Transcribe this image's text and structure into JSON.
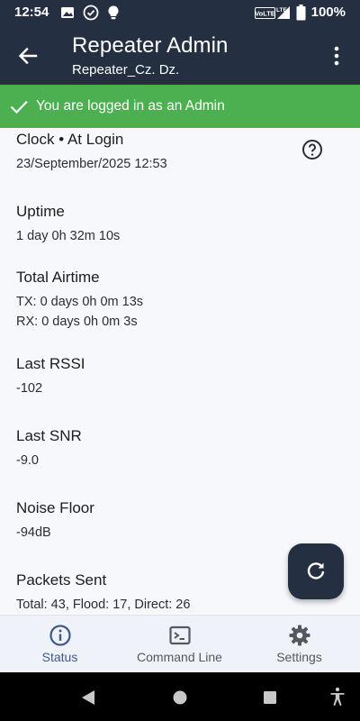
{
  "status_bar": {
    "time": "12:54",
    "left_icons": [
      "image-icon",
      "check-circle-icon",
      "lightbulb-icon"
    ],
    "right_icons": [
      "volte-icon",
      "lte-signal-icon",
      "battery-icon"
    ],
    "volte_label": "VoLTE",
    "lte_label": "LTE",
    "battery": "100%"
  },
  "app_bar": {
    "title": "Repeater Admin",
    "subtitle": "Repeater_Cz. Dz."
  },
  "banner": {
    "text": "You are logged in as an Admin",
    "color": "#4caf50"
  },
  "stats": [
    {
      "title": "Clock • At Login",
      "lines": [
        "23/September/2025 12:53"
      ]
    },
    {
      "title": "Uptime",
      "lines": [
        "1 day 0h 32m 10s"
      ]
    },
    {
      "title": "Total Airtime",
      "lines": [
        "TX: 0 days 0h 0m 13s",
        "RX: 0 days 0h 0m 3s"
      ]
    },
    {
      "title": "Last RSSI",
      "lines": [
        "-102"
      ]
    },
    {
      "title": "Last SNR",
      "lines": [
        "-9.0"
      ]
    },
    {
      "title": "Noise Floor",
      "lines": [
        "-94dB"
      ]
    },
    {
      "title": "Packets Sent",
      "lines": [
        "Total: 43, Flood: 17, Direct: 26"
      ]
    }
  ],
  "fab": {
    "icon": "refresh-icon"
  },
  "bottom_nav": {
    "items": [
      {
        "label": "Status",
        "icon": "info-icon",
        "selected": true
      },
      {
        "label": "Command Line",
        "icon": "terminal-icon",
        "selected": false
      },
      {
        "label": "Settings",
        "icon": "gear-icon",
        "selected": false
      }
    ],
    "selected_color": "#3e5a87"
  },
  "system_nav": [
    "back-triangle-icon",
    "home-circle-icon",
    "recents-square-icon",
    "accessibility-icon"
  ],
  "colors": {
    "primary": "#243041",
    "background": "#f7f8fc",
    "success": "#4caf50"
  }
}
